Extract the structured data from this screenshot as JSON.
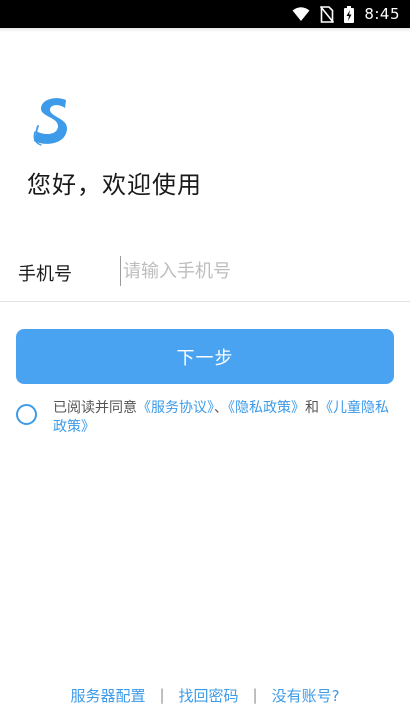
{
  "status_bar": {
    "time": "8:45",
    "icons": [
      "wifi-icon",
      "no-sim-icon",
      "battery-charging-icon"
    ]
  },
  "logo": {
    "icon": "app-logo-s-icon",
    "color": "#3d9be9"
  },
  "welcome": "您好，欢迎使用",
  "phone": {
    "label": "手机号",
    "placeholder": "请输入手机号",
    "value": ""
  },
  "next_button": {
    "label": "下一步",
    "color": "#4aa3f1"
  },
  "agreement": {
    "checked": false,
    "prefix": "已阅读并同意",
    "service_agreement": "《服务协议》",
    "sep1": "、",
    "privacy_policy": "《隐私政策》",
    "and": "和",
    "children_privacy": "《儿童隐私政策》"
  },
  "footer": {
    "server_config": "服务器配置",
    "sep": "|",
    "find_password": "找回密码",
    "no_account": "没有账号?"
  },
  "colors": {
    "accent": "#3d9be9",
    "button": "#4aa3f1"
  }
}
